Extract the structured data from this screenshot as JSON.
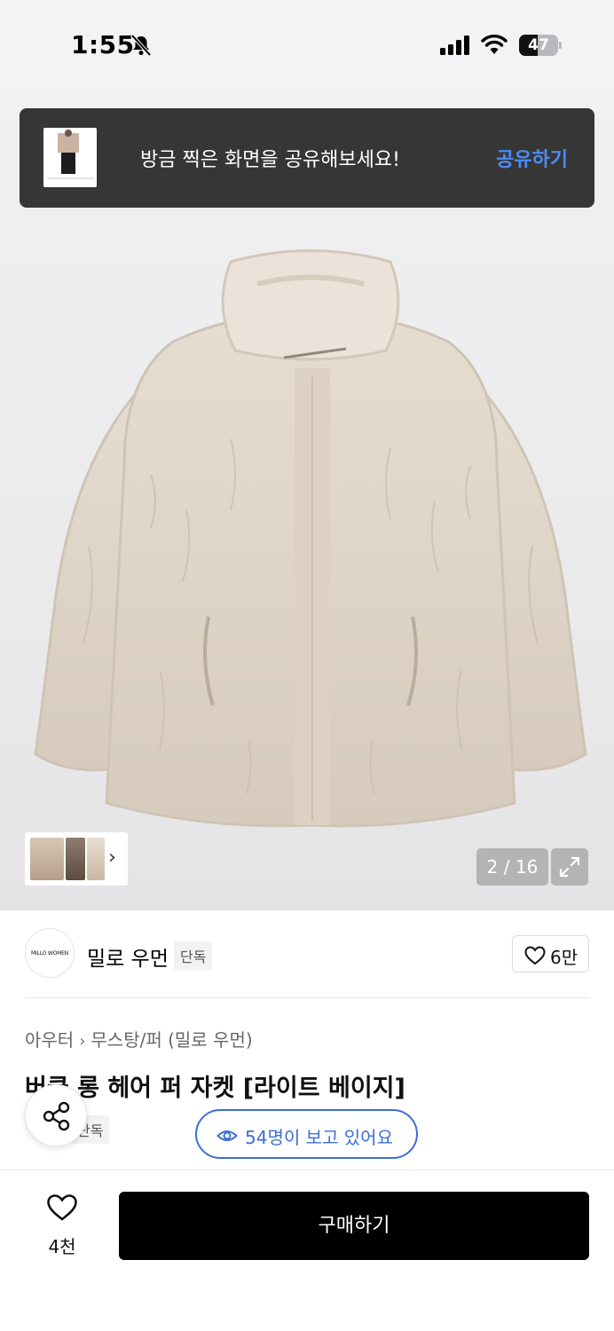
{
  "status_bar": {
    "time": "1:55",
    "battery": "47",
    "battery_level": 0.47
  },
  "toast": {
    "message": "방금 찍은 화면을 공유해보세요!",
    "action": "공유하기"
  },
  "gallery": {
    "counter": "2 / 16"
  },
  "brand": {
    "logo_text": "MILLO WOMEN",
    "name": "밀로 우먼",
    "tag": "단독",
    "likes": "6만"
  },
  "product": {
    "breadcrumb": [
      "아우터",
      "무스탕/퍼 (밀로 우먼)"
    ],
    "title": "버클 롱 헤어 퍼 자켓 [라이트 베이지]",
    "tag": "단독"
  },
  "viewers": {
    "text": "54명이 보고 있어요"
  },
  "bottom_bar": {
    "wish_count": "4천",
    "buy_label": "구매하기"
  },
  "colors": {
    "accent_blue": "#3c6fd4",
    "toast_bg": "#363636",
    "toast_action": "#4d8bf5",
    "buy_bg": "#000000",
    "fur": "#ddd3c6"
  }
}
